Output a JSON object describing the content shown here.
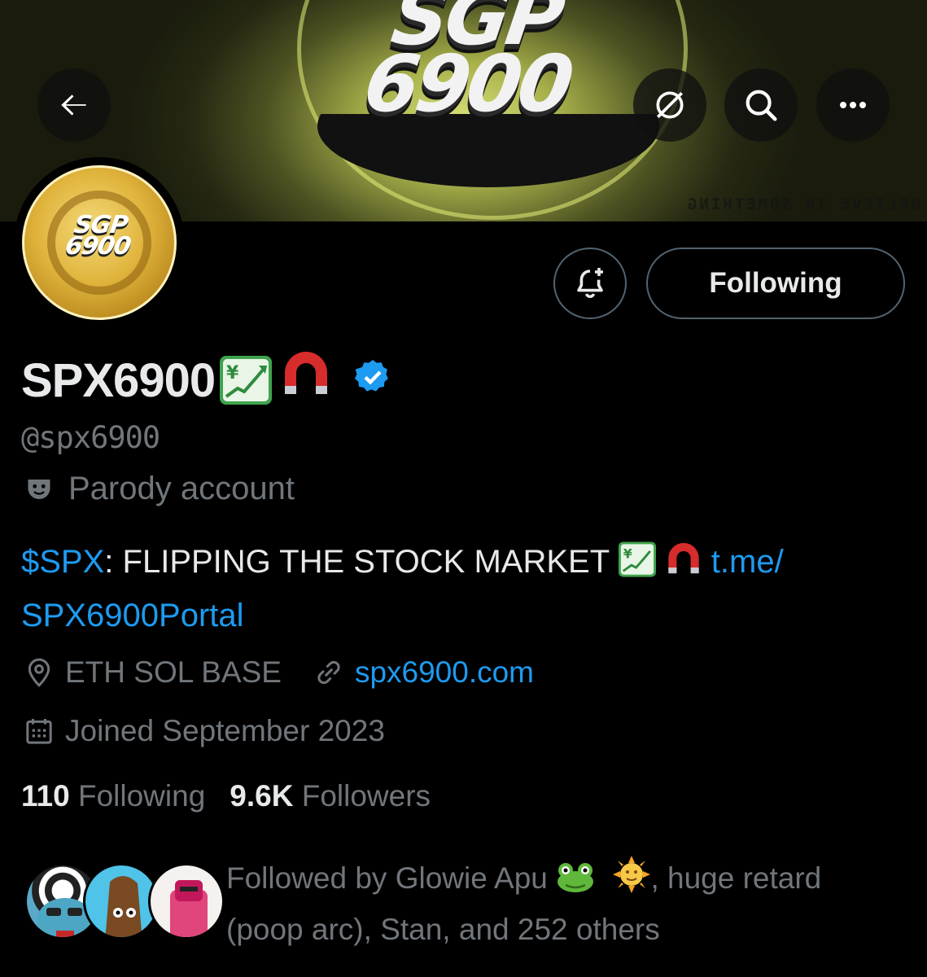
{
  "banner": {
    "logo_line1": "SGP",
    "logo_line2": "6900",
    "tagline": "BELIEVE IN SOMETHING"
  },
  "header_icons": {
    "back": "arrow-left-icon",
    "translate": "globe-slash-icon",
    "search": "search-icon",
    "more": "more-horizontal-icon"
  },
  "avatar": {
    "line1": "SGP",
    "line2": "6900"
  },
  "actions": {
    "notify_icon": "bell-plus-icon",
    "follow_label": "Following"
  },
  "profile": {
    "display_name": "SPX6900",
    "name_emojis": [
      "chart-yen-icon",
      "magnet-icon"
    ],
    "verified_icon": "verified-badge-icon",
    "handle": "@spx6900",
    "label_icon": "theater-mask-icon",
    "label": "Parody account"
  },
  "bio": {
    "cashtag": "$SPX",
    "text": ": FLIPPING THE STOCK MARKET ",
    "link_part1": "t.me/",
    "link_part2": "SPX6900Portal"
  },
  "meta": {
    "location_icon": "location-pin-icon",
    "location": "ETH SOL BASE",
    "website_icon": "link-icon",
    "website": "spx6900.com",
    "joined_icon": "calendar-icon",
    "joined": "Joined September 2023"
  },
  "stats": {
    "following_count": "110",
    "following_label": "Following",
    "followers_count": "9.6K",
    "followers_label": "Followers"
  },
  "followed_by": {
    "prefix": "Followed by Glowie Apu ",
    "emojis": [
      "frog-icon",
      "sun-face-icon"
    ],
    "middle": ", huge retard",
    "rest": "(poop arc), Stan, and 252 others"
  },
  "colors": {
    "background": "#000000",
    "primary_text": "#e7e9ea",
    "secondary_text": "#71767b",
    "link": "#1d9bf0",
    "border": "#536471",
    "verified": "#1d9bf0"
  }
}
